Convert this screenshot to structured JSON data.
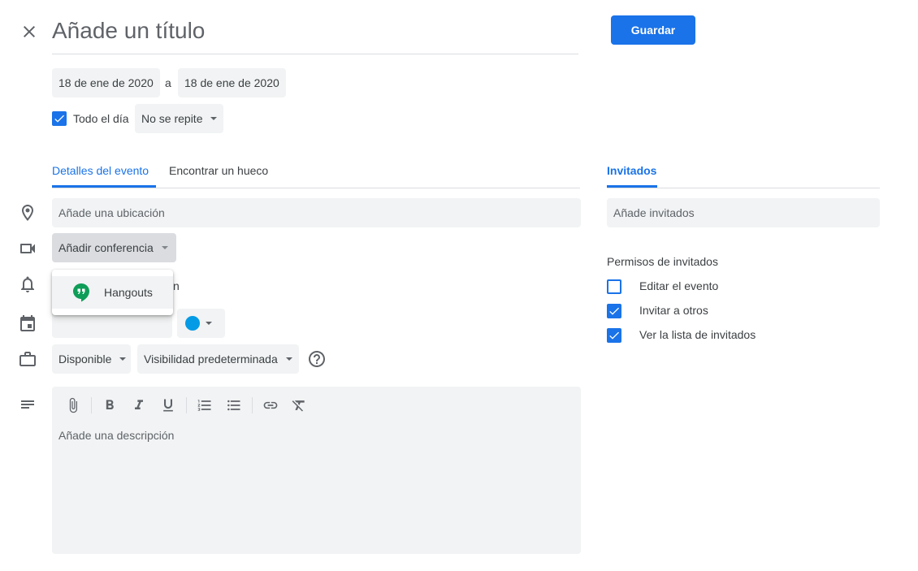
{
  "header": {
    "close_icon": "close-icon",
    "title_placeholder": "Añade un título",
    "save_label": "Guardar"
  },
  "dates": {
    "start": "18 de ene de 2020",
    "separator": "a",
    "end": "18 de ene de 2020"
  },
  "all_day": {
    "label": "Todo el día",
    "checked": true
  },
  "repeat": {
    "value": "No se repite"
  },
  "tabs": [
    {
      "label": "Detalles del evento",
      "active": true
    },
    {
      "label": "Encontrar un hueco",
      "active": false
    }
  ],
  "location": {
    "placeholder": "Añade una ubicación",
    "icon": "location-pin-icon"
  },
  "conference": {
    "label": "Añadir conferencia",
    "icon": "video-camera-icon",
    "menu": [
      {
        "label": "Hangouts",
        "icon": "hangouts-icon"
      }
    ]
  },
  "notification": {
    "icon": "bell-icon",
    "partial_text": "n"
  },
  "calendar": {
    "icon": "calendar-icon",
    "color": "#039be5"
  },
  "availability": {
    "icon": "briefcase-icon",
    "status": "Disponible",
    "visibility": "Visibilidad predeterminada",
    "help_icon": "help-icon"
  },
  "description": {
    "icon": "notes-icon",
    "placeholder": "Añade una descripción",
    "toolbar": [
      "attach-icon",
      "bold-icon",
      "italic-icon",
      "underline-icon",
      "numbered-list-icon",
      "bulleted-list-icon",
      "link-icon",
      "clear-format-icon"
    ]
  },
  "guests": {
    "tab_label": "Invitados",
    "placeholder": "Añade invitados",
    "permissions_title": "Permisos de invitados",
    "permissions": [
      {
        "label": "Editar el evento",
        "checked": false
      },
      {
        "label": "Invitar a otros",
        "checked": true
      },
      {
        "label": "Ver la lista de invitados",
        "checked": true
      }
    ]
  },
  "colors": {
    "accent": "#1a73e8",
    "field_bg": "#f1f3f4",
    "text": "#3c4043"
  }
}
